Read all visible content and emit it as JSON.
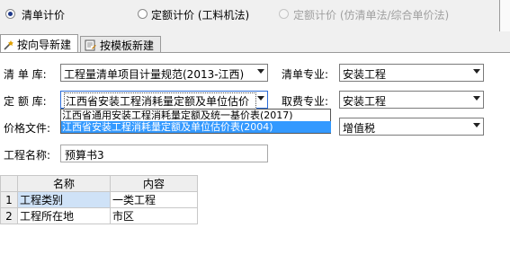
{
  "radios": [
    {
      "label": "清单计价",
      "checked": true,
      "enabled": true
    },
    {
      "label": "定额计价 (工料机法)",
      "checked": false,
      "enabled": true
    },
    {
      "label": "定额计价 (仿清单法/综合单价法)",
      "checked": false,
      "enabled": false
    }
  ],
  "tabs": [
    {
      "label": "按向导新建",
      "icon": "wizard-icon",
      "active": true
    },
    {
      "label": "按模板新建",
      "icon": "template-icon",
      "active": false
    }
  ],
  "form": {
    "list_lib_label": "清 单 库:",
    "list_lib_value": "工程量清单项目计量规范(2013-江西)",
    "list_major_label": "清单专业:",
    "list_major_value": "安装工程",
    "quota_lib_label": "定 额 库:",
    "quota_lib_value": "江西省安装工程消耗量定额及单位估价",
    "fee_major_label": "取费专业:",
    "fee_major_value": "安装工程",
    "price_file_label": "价格文件:",
    "tax_value": "增值税",
    "project_name_label": "工程名称:",
    "project_name_value": "预算书3"
  },
  "quota_dropdown": {
    "options": [
      "江西省通用安装工程消耗量定额及统一基价表(2017)",
      "江西省安装工程消耗量定额及单位估价表(2004)"
    ],
    "selected_index": 1
  },
  "grid": {
    "columns": [
      "名称",
      "内容"
    ],
    "rows": [
      {
        "index": "1",
        "name": "工程类别",
        "content": "一类工程"
      },
      {
        "index": "2",
        "name": "工程所在地",
        "content": "市区"
      }
    ]
  }
}
